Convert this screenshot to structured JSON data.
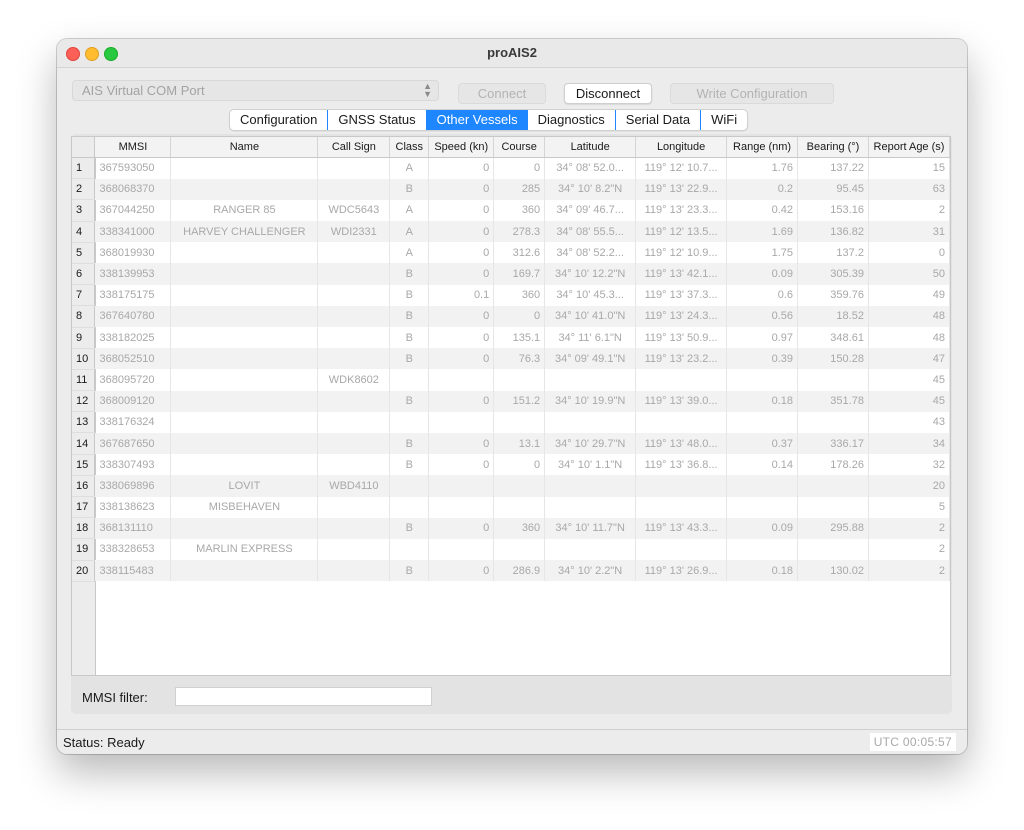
{
  "window": {
    "title": "proAIS2"
  },
  "toolbar": {
    "port_value": "AIS Virtual COM Port",
    "connect_label": "Connect",
    "disconnect_label": "Disconnect",
    "write_label": "Write Configuration"
  },
  "tabs": [
    {
      "label": "Configuration"
    },
    {
      "label": "GNSS Status"
    },
    {
      "label": "Other Vessels"
    },
    {
      "label": "Diagnostics"
    },
    {
      "label": "Serial Data"
    },
    {
      "label": "WiFi"
    }
  ],
  "table": {
    "columns": [
      "MMSI",
      "Name",
      "Call Sign",
      "Class",
      "Speed (kn)",
      "Course",
      "Latitude",
      "Longitude",
      "Range (nm)",
      "Bearing (°)",
      "Report Age (s)"
    ],
    "rows": [
      [
        "1",
        "367593050",
        "",
        "",
        "A",
        "0",
        "0",
        "34° 08' 52.0...",
        "119° 12' 10.7...",
        "1.76",
        "137.22",
        "15"
      ],
      [
        "2",
        "368068370",
        "",
        "",
        "B",
        "0",
        "285",
        "34° 10' 8.2\"N",
        "119° 13' 22.9...",
        "0.2",
        "95.45",
        "63"
      ],
      [
        "3",
        "367044250",
        "RANGER 85",
        "WDC5643",
        "A",
        "0",
        "360",
        "34° 09' 46.7...",
        "119° 13' 23.3...",
        "0.42",
        "153.16",
        "2"
      ],
      [
        "4",
        "338341000",
        "HARVEY CHALLENGER",
        "WDI2331",
        "A",
        "0",
        "278.3",
        "34° 08' 55.5...",
        "119° 12' 13.5...",
        "1.69",
        "136.82",
        "31"
      ],
      [
        "5",
        "368019930",
        "",
        "",
        "A",
        "0",
        "312.6",
        "34° 08' 52.2...",
        "119° 12' 10.9...",
        "1.75",
        "137.2",
        "0"
      ],
      [
        "6",
        "338139953",
        "",
        "",
        "B",
        "0",
        "169.7",
        "34° 10' 12.2\"N",
        "119° 13' 42.1...",
        "0.09",
        "305.39",
        "50"
      ],
      [
        "7",
        "338175175",
        "",
        "",
        "B",
        "0.1",
        "360",
        "34° 10' 45.3...",
        "119° 13' 37.3...",
        "0.6",
        "359.76",
        "49"
      ],
      [
        "8",
        "367640780",
        "",
        "",
        "B",
        "0",
        "0",
        "34° 10' 41.0\"N",
        "119° 13' 24.3...",
        "0.56",
        "18.52",
        "48"
      ],
      [
        "9",
        "338182025",
        "",
        "",
        "B",
        "0",
        "135.1",
        "34° 11' 6.1\"N",
        "119° 13' 50.9...",
        "0.97",
        "348.61",
        "48"
      ],
      [
        "10",
        "368052510",
        "",
        "",
        "B",
        "0",
        "76.3",
        "34° 09' 49.1\"N",
        "119° 13' 23.2...",
        "0.39",
        "150.28",
        "47"
      ],
      [
        "11",
        "368095720",
        "",
        "WDK8602",
        "",
        "",
        "",
        "",
        "",
        "",
        "",
        "45"
      ],
      [
        "12",
        "368009120",
        "",
        "",
        "B",
        "0",
        "151.2",
        "34° 10' 19.9\"N",
        "119° 13' 39.0...",
        "0.18",
        "351.78",
        "45"
      ],
      [
        "13",
        "338176324",
        "",
        "",
        "",
        "",
        "",
        "",
        "",
        "",
        "",
        "43"
      ],
      [
        "14",
        "367687650",
        "",
        "",
        "B",
        "0",
        "13.1",
        "34° 10' 29.7\"N",
        "119° 13' 48.0...",
        "0.37",
        "336.17",
        "34"
      ],
      [
        "15",
        "338307493",
        "",
        "",
        "B",
        "0",
        "0",
        "34° 10' 1.1\"N",
        "119° 13' 36.8...",
        "0.14",
        "178.26",
        "32"
      ],
      [
        "16",
        "338069896",
        "LOVIT",
        "WBD4110",
        "",
        "",
        "",
        "",
        "",
        "",
        "",
        "20"
      ],
      [
        "17",
        "338138623",
        "MISBEHAVEN",
        "",
        "",
        "",
        "",
        "",
        "",
        "",
        "",
        "5"
      ],
      [
        "18",
        "368131110",
        "",
        "",
        "B",
        "0",
        "360",
        "34° 10' 11.7\"N",
        "119° 13' 43.3...",
        "0.09",
        "295.88",
        "2"
      ],
      [
        "19",
        "338328653",
        "MARLIN EXPRESS",
        "",
        "",
        "",
        "",
        "",
        "",
        "",
        "",
        "2"
      ],
      [
        "20",
        "338115483",
        "",
        "",
        "B",
        "0",
        "286.9",
        "34° 10' 2.2\"N",
        "119° 13' 26.9...",
        "0.18",
        "130.02",
        "2"
      ]
    ]
  },
  "filter": {
    "label": "MMSI filter:",
    "value": ""
  },
  "status": {
    "text": "Status: Ready",
    "clock": "UTC  00:05:57"
  }
}
